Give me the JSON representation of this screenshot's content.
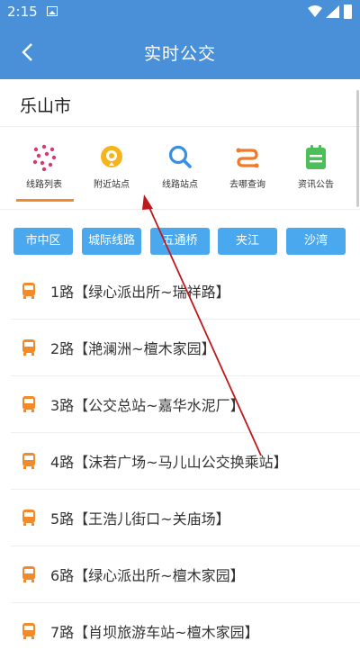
{
  "status_bar": {
    "time": "2:15"
  },
  "header": {
    "title": "实时公交"
  },
  "city": "乐山市",
  "nav": [
    {
      "label": "线路列表",
      "icon": "route-list-icon",
      "color": "#d63a6e"
    },
    {
      "label": "附近站点",
      "icon": "location-pin-icon",
      "color": "#f5b41e"
    },
    {
      "label": "线路站点",
      "icon": "search-icon",
      "color": "#3a8fe0"
    },
    {
      "label": "去哪查询",
      "icon": "route-path-icon",
      "color": "#f07a2a"
    },
    {
      "label": "资讯公告",
      "icon": "notice-board-icon",
      "color": "#4cbf5a"
    }
  ],
  "chips": [
    "市中区",
    "城际线路",
    "五通桥",
    "夹江",
    "沙湾"
  ],
  "routes": [
    "1路【绿心派出所~瑞祥路】",
    "2路【滟澜洲~檀木家园】",
    "3路【公交总站~嘉华水泥厂】",
    "4路【沫若广场~马儿山公交换乘站】",
    "5路【王浩儿街口~关庙场】",
    "6路【绿心派出所~檀木家园】",
    "7路【肖坝旅游车站~檀木家园】"
  ],
  "colors": {
    "primary": "#4a90d9",
    "chip": "#4aa8ee",
    "accent": "#f08a2a",
    "annotation": "#c0181b"
  }
}
